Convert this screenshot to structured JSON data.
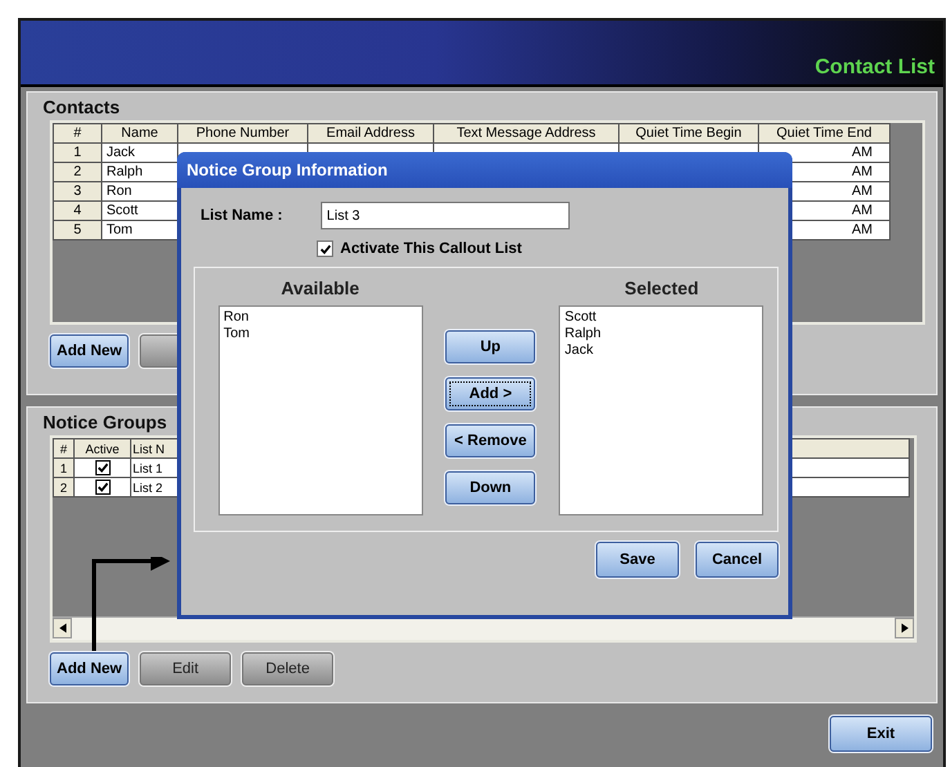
{
  "app": {
    "title": "Contact List"
  },
  "contacts": {
    "title": "Contacts",
    "columns": [
      "#",
      "Name",
      "Phone Number",
      "Email Address",
      "Text Message Address",
      "Quiet Time Begin",
      "Quiet Time End"
    ],
    "rows": [
      {
        "number": "1",
        "name": "Jack",
        "quiet_time_end": "AM"
      },
      {
        "number": "2",
        "name": "Ralph",
        "quiet_time_end": "AM"
      },
      {
        "number": "3",
        "name": "Ron",
        "quiet_time_end": "AM"
      },
      {
        "number": "4",
        "name": "Scott",
        "quiet_time_end": "AM"
      },
      {
        "number": "5",
        "name": "Tom",
        "quiet_time_end": "AM"
      }
    ],
    "buttons": [
      {
        "label": "Add New",
        "kind": "primary"
      },
      {
        "kind": "plain"
      }
    ]
  },
  "notice_groups": {
    "title": "Notice Groups",
    "columns": [
      "#",
      "Active",
      "List N"
    ],
    "rows": [
      {
        "number": "1",
        "active": true,
        "list": "List 1"
      },
      {
        "number": "2",
        "active": true,
        "list": "List 2"
      }
    ],
    "buttons": [
      {
        "label": "Add New",
        "kind": "primary"
      },
      {
        "label": "Edit",
        "kind": "plain"
      },
      {
        "label": "Delete",
        "kind": "plain"
      }
    ]
  },
  "exit_button": "Exit",
  "dialog": {
    "title": "Notice Group Information",
    "list_name": {
      "label": "List Name :",
      "value": "List 3"
    },
    "activate": {
      "label": "Activate This Callout List",
      "checked": true
    },
    "available": {
      "title": "Available",
      "items": [
        "Ron",
        "Tom"
      ]
    },
    "selected": {
      "title": "Selected",
      "items": [
        "Scott",
        "Ralph",
        "Jack"
      ]
    },
    "move_buttons": [
      {
        "label": "Up",
        "focused": false
      },
      {
        "label": "Add >",
        "focused": true
      },
      {
        "label": "< Remove",
        "focused": false
      },
      {
        "label": "Down",
        "focused": false
      }
    ],
    "actions": [
      "Save",
      "Cancel"
    ]
  }
}
